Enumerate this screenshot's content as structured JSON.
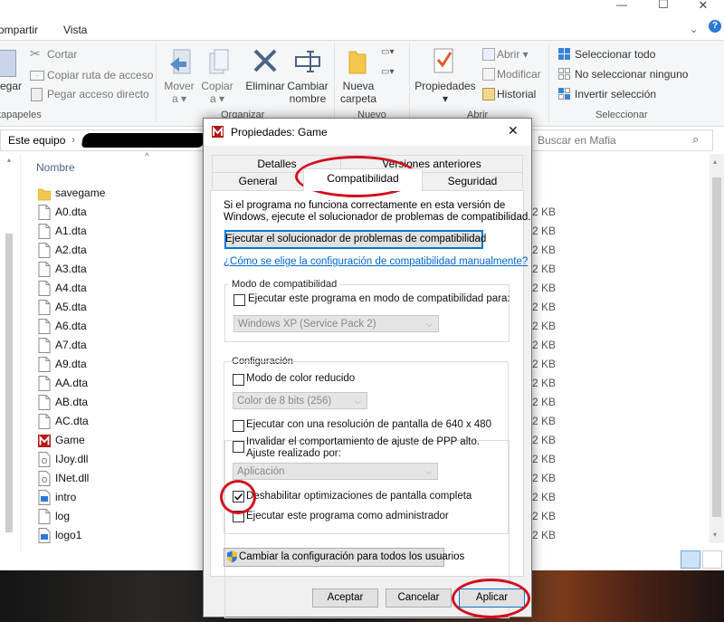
{
  "explorer": {
    "window_controls": {
      "minimize": "—",
      "maximize": "☐",
      "close": "✕"
    },
    "tabs": [
      "ompartir",
      "Vista"
    ],
    "ribbon": {
      "clipboard": {
        "paste_label": "egar",
        "cut": "Cortar",
        "copy_path": "Copiar ruta de acceso",
        "paste_shortcut": "Pegar acceso directo",
        "group_label": "tapapeles"
      },
      "organize": {
        "move": [
          "Mover",
          "a"
        ],
        "copy": [
          "Copiar",
          "a"
        ],
        "delete": "Eliminar",
        "rename": [
          "Cambiar",
          "nombre"
        ],
        "group_label": "Organizar"
      },
      "new": {
        "new_folder": [
          "Nueva",
          "carpeta"
        ],
        "group_label": "Nuevo"
      },
      "open": {
        "properties": "Propiedades",
        "open": "Abrir",
        "edit": "Modificar",
        "history": "Historial",
        "group_label": "Abrir"
      },
      "select": {
        "select_all": "Seleccionar todo",
        "select_none": "No seleccionar ninguno",
        "invert": "Invertir selección",
        "group_label": "Seleccionar"
      }
    },
    "address": {
      "root": "Este equipo",
      "separator": "›"
    },
    "search": {
      "placeholder": "Buscar en Mafia"
    },
    "column_header": "Nombre",
    "files": [
      {
        "name": "savegame",
        "type": "folder"
      },
      {
        "name": "A0.dta",
        "type": "file",
        "size": "2 KB"
      },
      {
        "name": "A1.dta",
        "type": "file",
        "size": "2 KB"
      },
      {
        "name": "A2.dta",
        "type": "file",
        "size": "2 KB"
      },
      {
        "name": "A3.dta",
        "type": "file",
        "size": "2 KB"
      },
      {
        "name": "A4.dta",
        "type": "file",
        "size": "2 KB"
      },
      {
        "name": "A5.dta",
        "type": "file",
        "size": "2 KB"
      },
      {
        "name": "A6.dta",
        "type": "file",
        "size": "2 KB"
      },
      {
        "name": "A7.dta",
        "type": "file",
        "size": "2 KB"
      },
      {
        "name": "A9.dta",
        "type": "file",
        "size": "2 KB"
      },
      {
        "name": "AA.dta",
        "type": "file",
        "size": "2 KB"
      },
      {
        "name": "AB.dta",
        "type": "file",
        "size": "2 KB"
      },
      {
        "name": "AC.dta",
        "type": "file",
        "size": "2 KB"
      },
      {
        "name": "Game",
        "type": "exe",
        "size": "2 KB"
      },
      {
        "name": "IJoy.dll",
        "type": "dll",
        "size": "2 KB"
      },
      {
        "name": "INet.dll",
        "type": "dll",
        "size": "2 KB"
      },
      {
        "name": "intro",
        "type": "media",
        "size": "2 KB"
      },
      {
        "name": "log",
        "type": "file",
        "size": "2 KB"
      },
      {
        "name": "logo1",
        "type": "media",
        "size": "2 KB"
      }
    ]
  },
  "dialog": {
    "title": "Propiedades: Game",
    "close": "✕",
    "tabs_back": [
      "Detalles",
      "Versiones anteriores"
    ],
    "tabs_front": [
      "General",
      "Compatibilidad",
      "Seguridad"
    ],
    "intro": [
      "Si el programa no funciona correctamente en esta versión de",
      "Windows, ejecute el solucionador de problemas de compatibilidad."
    ],
    "troubleshooter_button": "Ejecutar el solucionador de problemas de compatibilidad",
    "manual_link": "¿Cómo se elige la configuración de compatibilidad manualmente?",
    "compat_mode": {
      "legend": "Modo de compatibilidad",
      "checkbox": "Ejecutar este programa en modo de compatibilidad para:",
      "checked": false,
      "os_value": "Windows XP (Service Pack 2)"
    },
    "settings": {
      "legend": "Configuración",
      "reduced_color": {
        "label": "Modo de color reducido",
        "checked": false
      },
      "color_value": "Color de 8 bits (256)",
      "res_640": {
        "label": "Ejecutar con una resolución de pantalla de 640 x 480",
        "checked": false
      },
      "dpi": {
        "label_lines": [
          "Invalidar el comportamiento de ajuste de PPP alto.",
          "Ajuste realizado por:"
        ],
        "checked": false
      },
      "dpi_value": "Aplicación",
      "fullscreen_opt": {
        "label": "Deshabilitar optimizaciones de pantalla completa",
        "checked": true
      },
      "admin": {
        "label": "Ejecutar este programa como administrador",
        "checked": false
      }
    },
    "all_users_button": "Cambiar la configuración para todos los usuarios",
    "buttons": {
      "ok": "Aceptar",
      "cancel": "Cancelar",
      "apply": "Aplicar"
    }
  },
  "colors": {
    "annotation_red": "#d0101e",
    "link_blue": "#0066cc",
    "ribbon_blue": "#2b79d0"
  }
}
